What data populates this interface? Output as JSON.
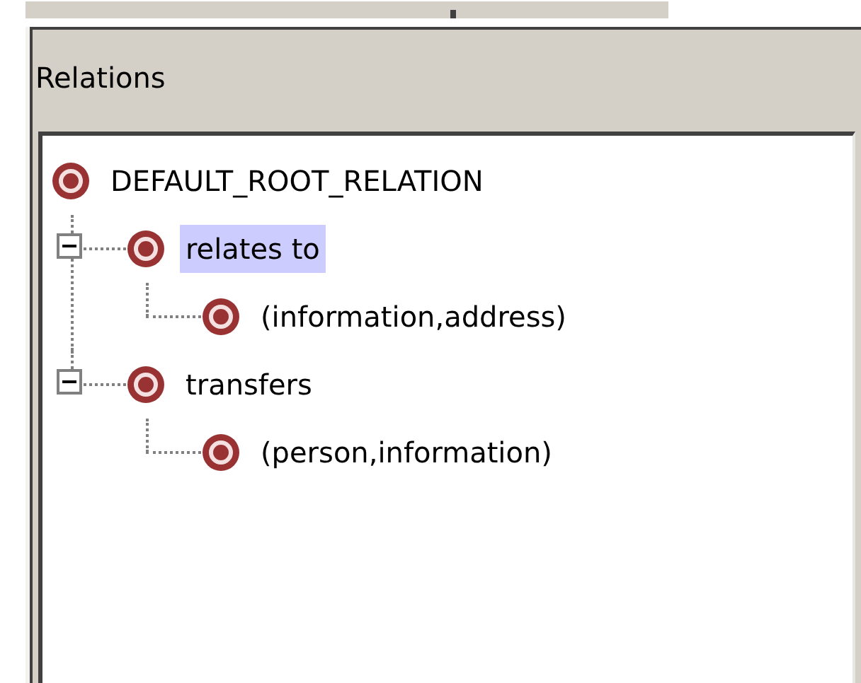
{
  "panel": {
    "title": "Relations"
  },
  "tree": [
    {
      "label": "DEFAULT_ROOT_RELATION",
      "selected": false,
      "children": [
        {
          "label": "relates to",
          "expanded": true,
          "selected": true,
          "children": [
            {
              "label": "(information,address)",
              "selected": false
            }
          ]
        },
        {
          "label": "transfers",
          "expanded": true,
          "selected": false,
          "children": [
            {
              "label": "(person,information)",
              "selected": false
            }
          ]
        }
      ]
    }
  ]
}
